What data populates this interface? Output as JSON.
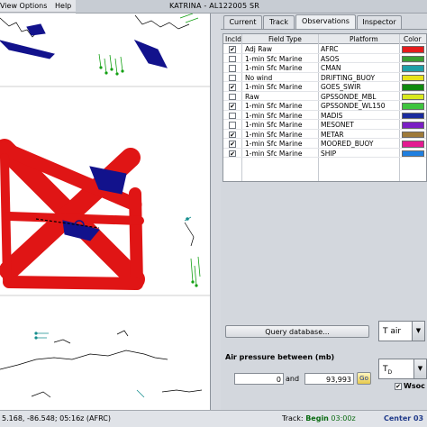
{
  "menubar": {
    "items": [
      "View Options",
      "Help"
    ]
  },
  "window": {
    "title": "KATRINA - AL122005 SR"
  },
  "tabs": [
    {
      "label": "Current"
    },
    {
      "label": "Track"
    },
    {
      "label": "Observations",
      "active": true
    },
    {
      "label": "Inspector"
    }
  ],
  "table": {
    "headers": {
      "incl": "Incld",
      "field_type": "Field Type",
      "platform": "Platform",
      "color": "Color"
    },
    "rows": [
      {
        "incl": true,
        "field_type": "Adj Raw",
        "platform": "AFRC",
        "color": "#e61b1b"
      },
      {
        "incl": false,
        "field_type": "1-min Sfc Marine",
        "platform": "ASOS",
        "color": "#3a9e32"
      },
      {
        "incl": false,
        "field_type": "1-min Sfc Marine",
        "platform": "CMAN",
        "color": "#1fa0a7"
      },
      {
        "incl": false,
        "field_type": "No wind",
        "platform": "DRIFTING_BUOY",
        "color": "#e8e31a"
      },
      {
        "incl": true,
        "field_type": "1-min Sfc Marine",
        "platform": "GOES_SWIR",
        "color": "#0f8a0f"
      },
      {
        "incl": false,
        "field_type": "Raw",
        "platform": "GPSSONDE_MBL",
        "color": "#d9e91f"
      },
      {
        "incl": true,
        "field_type": "1-min Sfc Marine",
        "platform": "GPSSONDE_WL150",
        "color": "#3fc43f"
      },
      {
        "incl": false,
        "field_type": "1-min Sfc Marine",
        "platform": "MADIS",
        "color": "#1a2b9e"
      },
      {
        "incl": false,
        "field_type": "1-min Sfc Marine",
        "platform": "MESONET",
        "color": "#7a1fc4"
      },
      {
        "incl": true,
        "field_type": "1-min Sfc Marine",
        "platform": "METAR",
        "color": "#9e7a3a"
      },
      {
        "incl": true,
        "field_type": "1-min Sfc Marine",
        "platform": "MOORED_BUOY",
        "color": "#e31a91"
      },
      {
        "incl": true,
        "field_type": "1-min Sfc Marine",
        "platform": "SHIP",
        "color": "#1f7fe0"
      }
    ]
  },
  "query": {
    "button_label": "Query database...",
    "air_pressure_label": "Air pressure between (mb)",
    "min_value": "0",
    "and_label": "and",
    "max_value": "93,993",
    "go_label": "Go"
  },
  "controls": {
    "tair_label": "T air",
    "td_label": "T",
    "td_subscript": "D",
    "wsoc_label": "Wsoc",
    "wsoc_checked": true
  },
  "statusbar": {
    "coord_text": "5.168, -86.548; 05:16z (AFRC)",
    "track_label": "Track:",
    "begin_label": "Begin",
    "begin_value": "03:00z",
    "center_label": "Center",
    "center_value": "03"
  },
  "map": {
    "coast_color": "#000000",
    "swath_color": "#e01515",
    "blue_obs_color": "#12128c",
    "green_obs_color": "#13a013",
    "teal_obs_color": "#168e8e"
  }
}
